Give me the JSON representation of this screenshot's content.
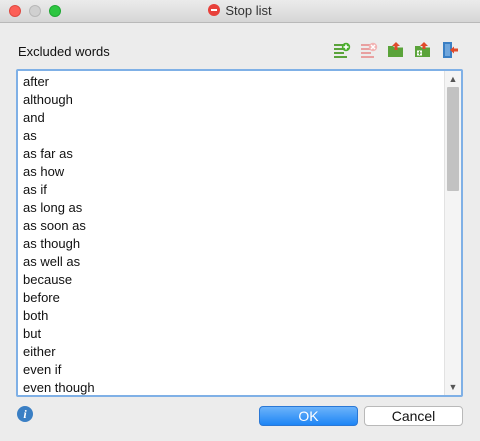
{
  "window": {
    "title": "Stop list"
  },
  "header": {
    "label": "Excluded words"
  },
  "toolbar": {
    "icons": [
      "add-word-icon",
      "delete-word-icon",
      "import-icon",
      "new-list-icon",
      "export-icon"
    ]
  },
  "list": {
    "items": [
      "after",
      "although",
      "and",
      "as",
      "as far as",
      "as how",
      "as if",
      "as long as",
      "as soon as",
      "as though",
      "as well as",
      "because",
      "before",
      "both",
      "but",
      "either",
      "even if",
      "even though"
    ]
  },
  "footer": {
    "info_glyph": "i",
    "ok_label": "OK",
    "cancel_label": "Cancel"
  },
  "colors": {
    "ok_accent": "#1e85f5",
    "list_border": "#7fb0e6",
    "close_red": "#fc5f57",
    "max_green": "#2dc641"
  }
}
